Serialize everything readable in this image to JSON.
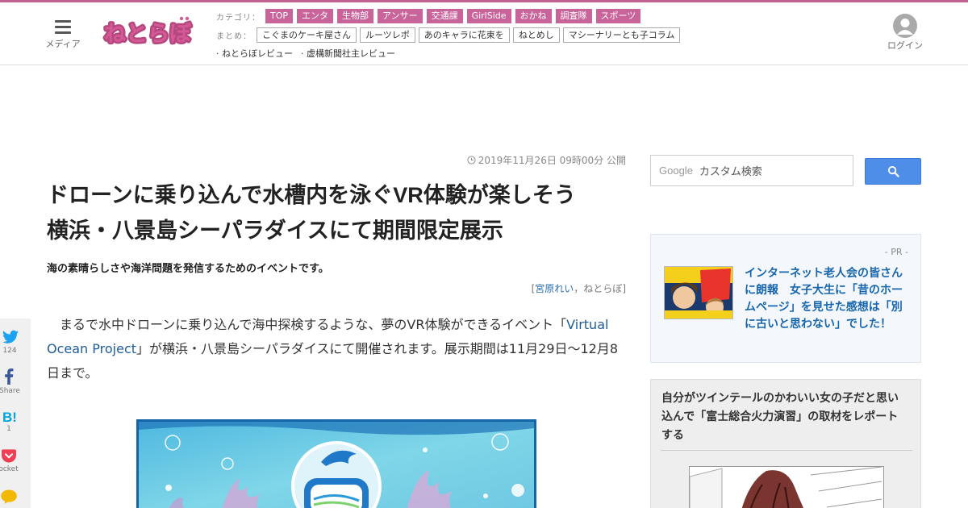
{
  "header": {
    "media_label": "メディア",
    "logo_text": "ねとらぼ",
    "category_heading": "カテゴリ：",
    "categories": [
      "TOP",
      "エンタ",
      "生物部",
      "アンサー",
      "交通課",
      "GirlSide",
      "おかね",
      "調査隊",
      "スポーツ"
    ],
    "matome_heading": "まとめ：",
    "matome": [
      "こぐまのケーキ屋さん",
      "ルーツレポ",
      "あのキャラに花束を",
      "ねとめし",
      "マシーナリーとも子コラム"
    ],
    "reviews": [
      "· ねとらぼレビュー",
      "· 虚構新聞社主レビュー"
    ],
    "login_label": "ログイン"
  },
  "article": {
    "date": "2019年11月26日 09時00分 公開",
    "title_line1": "ドローンに乗り込んで水槽内を泳ぐVR体験が楽しそう",
    "title_line2": "横浜・八景島シーパラダイスにて期間限定展示",
    "subtitle": "海の素晴らしさや海洋問題を発信するためのイベントです。",
    "author_open": "[",
    "author_name": "宮原れい",
    "author_sep": "，",
    "author_site": "ねとらぼ",
    "author_close": "]",
    "body_pre": "まるで水中ドローンに乗り込んで海中探検するような、夢のVR体験ができるイベント「",
    "body_link": "Virtual Ocean Project",
    "body_post": "」が横浜・八景島シーパラダイスにて開催されます。展示期間は11月29日～12月8日まで。"
  },
  "share": {
    "twitter_count": "124",
    "facebook_label": "Share",
    "hatena_count": "1",
    "pocket_label": "Pocket"
  },
  "sidebar": {
    "search_brand": "Google",
    "search_placeholder": "カスタム検索",
    "pr_label": "- PR -",
    "pr_title": "インターネット老人会の皆さんに朗報　女子大生に「昔のホームページ」を見せた感想は「別に古いと思わない」でした！",
    "related_title": "自分がツインテールのかわいい女の子だと思い込んで「富士総合火力演習」の取材をレポートする"
  },
  "colors": {
    "brand_pink": "#c8649a",
    "link_blue": "#1766ae",
    "search_blue": "#4f8ee8"
  }
}
